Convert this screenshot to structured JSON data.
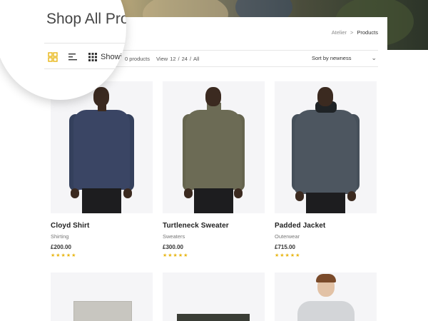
{
  "header": {
    "title": "Shop All Products",
    "breadcrumb": [
      "Atelier",
      "Products"
    ],
    "breadcrumb_separator": ">"
  },
  "toolbar": {
    "showing_text": "Showing",
    "count_text": "0 products",
    "view_label": "View",
    "view_options": [
      "12",
      "24",
      "All"
    ],
    "view_separator": "/",
    "sort_label": "Sort by newness",
    "layout_icons": [
      "grid-2-icon",
      "list-icon",
      "grid-3-icon"
    ],
    "active_icon_color": "#e8b616"
  },
  "products": [
    {
      "name": "Cloyd Shirt",
      "category": "Shirting",
      "price": "£200.00",
      "rating": 5,
      "garment_color": "#3a4564"
    },
    {
      "name": "Turtleneck Sweater",
      "category": "Sweaters",
      "price": "£300.00",
      "rating": 5,
      "garment_color": "#6c6b55"
    },
    {
      "name": "Padded Jacket",
      "category": "Outerwear",
      "price": "£715.00",
      "rating": 5,
      "garment_color": "#4d5660"
    }
  ],
  "stars_glyph": "★★★★★"
}
